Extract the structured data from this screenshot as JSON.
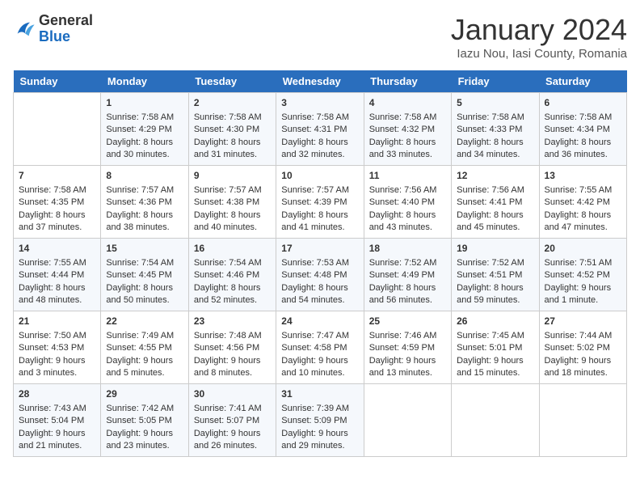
{
  "logo": {
    "general": "General",
    "blue": "Blue"
  },
  "title": "January 2024",
  "location": "Iazu Nou, Iasi County, Romania",
  "days_of_week": [
    "Sunday",
    "Monday",
    "Tuesday",
    "Wednesday",
    "Thursday",
    "Friday",
    "Saturday"
  ],
  "weeks": [
    [
      {
        "day": "",
        "sunrise": "",
        "sunset": "",
        "daylight": ""
      },
      {
        "day": "1",
        "sunrise": "Sunrise: 7:58 AM",
        "sunset": "Sunset: 4:29 PM",
        "daylight": "Daylight: 8 hours and 30 minutes."
      },
      {
        "day": "2",
        "sunrise": "Sunrise: 7:58 AM",
        "sunset": "Sunset: 4:30 PM",
        "daylight": "Daylight: 8 hours and 31 minutes."
      },
      {
        "day": "3",
        "sunrise": "Sunrise: 7:58 AM",
        "sunset": "Sunset: 4:31 PM",
        "daylight": "Daylight: 8 hours and 32 minutes."
      },
      {
        "day": "4",
        "sunrise": "Sunrise: 7:58 AM",
        "sunset": "Sunset: 4:32 PM",
        "daylight": "Daylight: 8 hours and 33 minutes."
      },
      {
        "day": "5",
        "sunrise": "Sunrise: 7:58 AM",
        "sunset": "Sunset: 4:33 PM",
        "daylight": "Daylight: 8 hours and 34 minutes."
      },
      {
        "day": "6",
        "sunrise": "Sunrise: 7:58 AM",
        "sunset": "Sunset: 4:34 PM",
        "daylight": "Daylight: 8 hours and 36 minutes."
      }
    ],
    [
      {
        "day": "7",
        "sunrise": "Sunrise: 7:58 AM",
        "sunset": "Sunset: 4:35 PM",
        "daylight": "Daylight: 8 hours and 37 minutes."
      },
      {
        "day": "8",
        "sunrise": "Sunrise: 7:57 AM",
        "sunset": "Sunset: 4:36 PM",
        "daylight": "Daylight: 8 hours and 38 minutes."
      },
      {
        "day": "9",
        "sunrise": "Sunrise: 7:57 AM",
        "sunset": "Sunset: 4:38 PM",
        "daylight": "Daylight: 8 hours and 40 minutes."
      },
      {
        "day": "10",
        "sunrise": "Sunrise: 7:57 AM",
        "sunset": "Sunset: 4:39 PM",
        "daylight": "Daylight: 8 hours and 41 minutes."
      },
      {
        "day": "11",
        "sunrise": "Sunrise: 7:56 AM",
        "sunset": "Sunset: 4:40 PM",
        "daylight": "Daylight: 8 hours and 43 minutes."
      },
      {
        "day": "12",
        "sunrise": "Sunrise: 7:56 AM",
        "sunset": "Sunset: 4:41 PM",
        "daylight": "Daylight: 8 hours and 45 minutes."
      },
      {
        "day": "13",
        "sunrise": "Sunrise: 7:55 AM",
        "sunset": "Sunset: 4:42 PM",
        "daylight": "Daylight: 8 hours and 47 minutes."
      }
    ],
    [
      {
        "day": "14",
        "sunrise": "Sunrise: 7:55 AM",
        "sunset": "Sunset: 4:44 PM",
        "daylight": "Daylight: 8 hours and 48 minutes."
      },
      {
        "day": "15",
        "sunrise": "Sunrise: 7:54 AM",
        "sunset": "Sunset: 4:45 PM",
        "daylight": "Daylight: 8 hours and 50 minutes."
      },
      {
        "day": "16",
        "sunrise": "Sunrise: 7:54 AM",
        "sunset": "Sunset: 4:46 PM",
        "daylight": "Daylight: 8 hours and 52 minutes."
      },
      {
        "day": "17",
        "sunrise": "Sunrise: 7:53 AM",
        "sunset": "Sunset: 4:48 PM",
        "daylight": "Daylight: 8 hours and 54 minutes."
      },
      {
        "day": "18",
        "sunrise": "Sunrise: 7:52 AM",
        "sunset": "Sunset: 4:49 PM",
        "daylight": "Daylight: 8 hours and 56 minutes."
      },
      {
        "day": "19",
        "sunrise": "Sunrise: 7:52 AM",
        "sunset": "Sunset: 4:51 PM",
        "daylight": "Daylight: 8 hours and 59 minutes."
      },
      {
        "day": "20",
        "sunrise": "Sunrise: 7:51 AM",
        "sunset": "Sunset: 4:52 PM",
        "daylight": "Daylight: 9 hours and 1 minute."
      }
    ],
    [
      {
        "day": "21",
        "sunrise": "Sunrise: 7:50 AM",
        "sunset": "Sunset: 4:53 PM",
        "daylight": "Daylight: 9 hours and 3 minutes."
      },
      {
        "day": "22",
        "sunrise": "Sunrise: 7:49 AM",
        "sunset": "Sunset: 4:55 PM",
        "daylight": "Daylight: 9 hours and 5 minutes."
      },
      {
        "day": "23",
        "sunrise": "Sunrise: 7:48 AM",
        "sunset": "Sunset: 4:56 PM",
        "daylight": "Daylight: 9 hours and 8 minutes."
      },
      {
        "day": "24",
        "sunrise": "Sunrise: 7:47 AM",
        "sunset": "Sunset: 4:58 PM",
        "daylight": "Daylight: 9 hours and 10 minutes."
      },
      {
        "day": "25",
        "sunrise": "Sunrise: 7:46 AM",
        "sunset": "Sunset: 4:59 PM",
        "daylight": "Daylight: 9 hours and 13 minutes."
      },
      {
        "day": "26",
        "sunrise": "Sunrise: 7:45 AM",
        "sunset": "Sunset: 5:01 PM",
        "daylight": "Daylight: 9 hours and 15 minutes."
      },
      {
        "day": "27",
        "sunrise": "Sunrise: 7:44 AM",
        "sunset": "Sunset: 5:02 PM",
        "daylight": "Daylight: 9 hours and 18 minutes."
      }
    ],
    [
      {
        "day": "28",
        "sunrise": "Sunrise: 7:43 AM",
        "sunset": "Sunset: 5:04 PM",
        "daylight": "Daylight: 9 hours and 21 minutes."
      },
      {
        "day": "29",
        "sunrise": "Sunrise: 7:42 AM",
        "sunset": "Sunset: 5:05 PM",
        "daylight": "Daylight: 9 hours and 23 minutes."
      },
      {
        "day": "30",
        "sunrise": "Sunrise: 7:41 AM",
        "sunset": "Sunset: 5:07 PM",
        "daylight": "Daylight: 9 hours and 26 minutes."
      },
      {
        "day": "31",
        "sunrise": "Sunrise: 7:39 AM",
        "sunset": "Sunset: 5:09 PM",
        "daylight": "Daylight: 9 hours and 29 minutes."
      },
      {
        "day": "",
        "sunrise": "",
        "sunset": "",
        "daylight": ""
      },
      {
        "day": "",
        "sunrise": "",
        "sunset": "",
        "daylight": ""
      },
      {
        "day": "",
        "sunrise": "",
        "sunset": "",
        "daylight": ""
      }
    ]
  ]
}
